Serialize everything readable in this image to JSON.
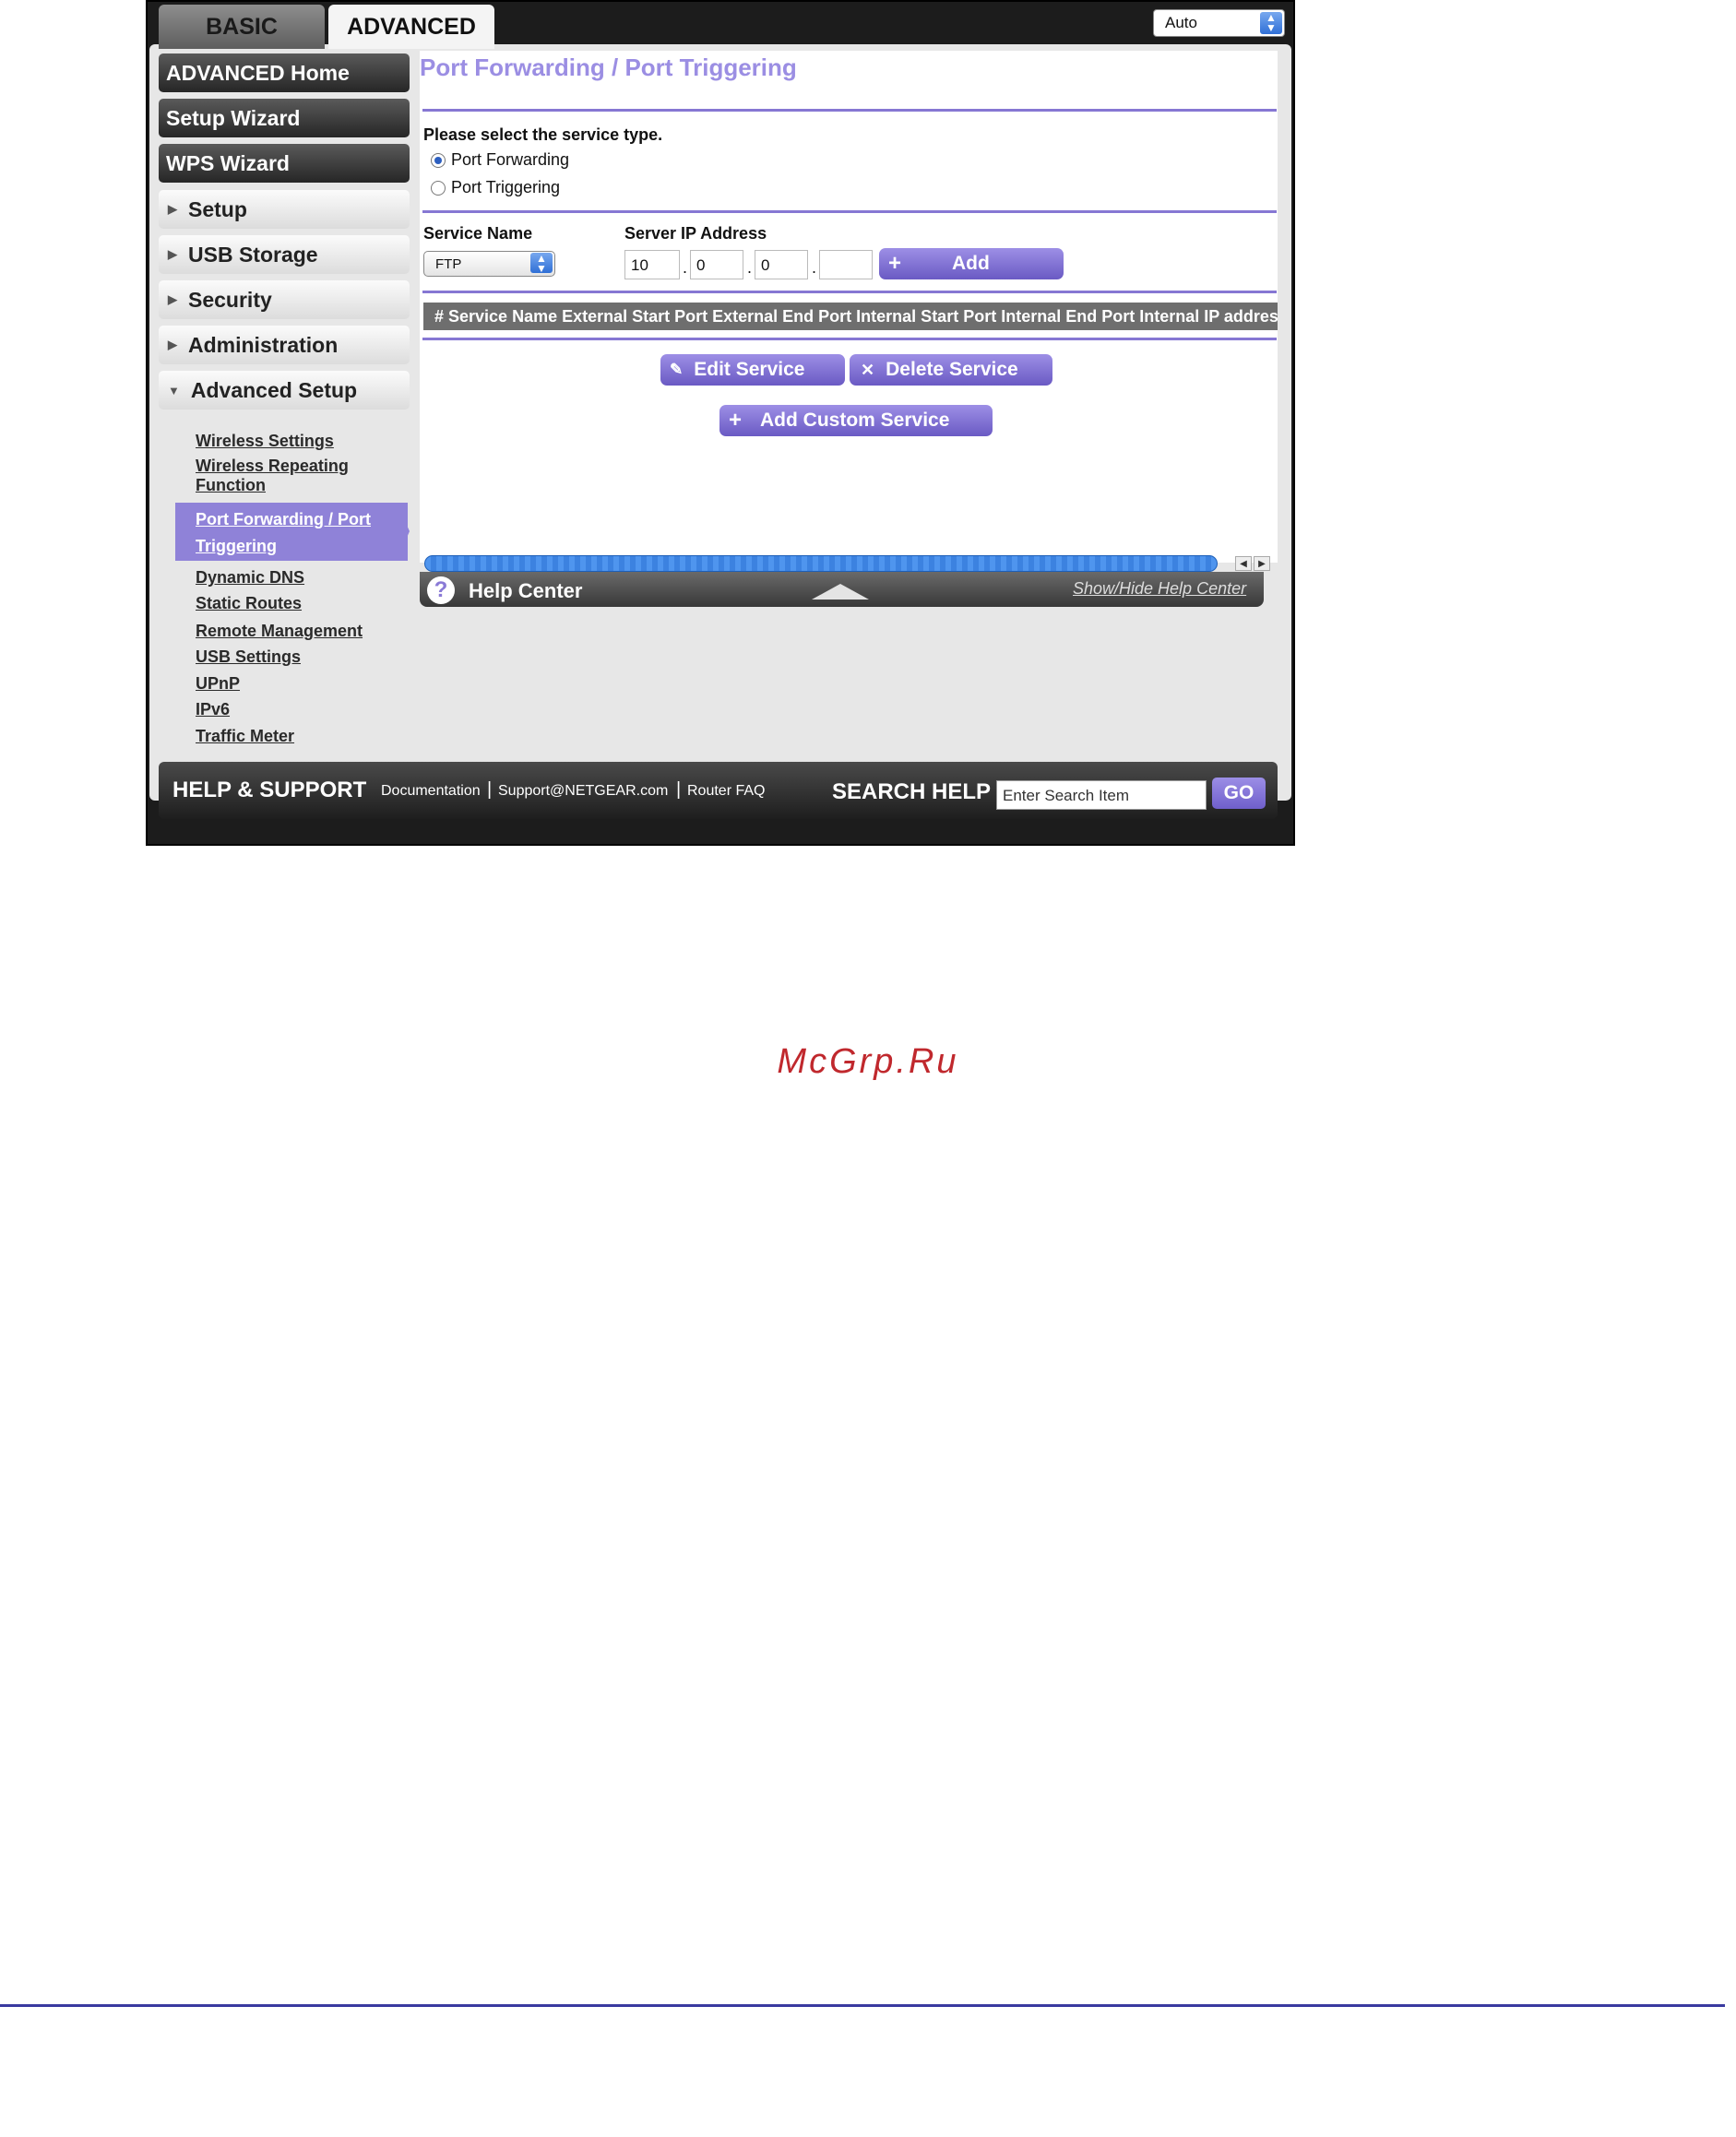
{
  "tabs": {
    "basic": "BASIC",
    "advanced": "ADVANCED"
  },
  "language_select": {
    "value": "Auto"
  },
  "sidebar": {
    "main_buttons": [
      "ADVANCED Home",
      "Setup Wizard",
      "WPS Wizard"
    ],
    "sections": [
      "Setup",
      "USB Storage",
      "Security",
      "Administration",
      "Advanced Setup"
    ],
    "sub_links": {
      "wireless_settings": "Wireless Settings",
      "wireless_repeating_1": "Wireless Repeating",
      "wireless_repeating_2": "Function",
      "port_forwarding_1": "Port Forwarding / Port",
      "port_forwarding_2": "Triggering",
      "dynamic_dns": "Dynamic DNS",
      "static_routes": "Static Routes",
      "remote_management": "Remote Management",
      "usb_settings": "USB Settings",
      "upnp": "UPnP",
      "ipv6": "IPv6",
      "traffic_meter": "Traffic Meter"
    }
  },
  "main": {
    "title": "Port Forwarding / Port Triggering",
    "service_type_prompt": "Please select the service type.",
    "radio_port_forwarding": "Port Forwarding",
    "radio_port_triggering": "Port Triggering",
    "service_name_label": "Service Name",
    "service_name_value": "FTP",
    "server_ip_label": "Server IP Address",
    "ip_octets": [
      "10",
      "0",
      "0",
      ""
    ],
    "add_label": "Add",
    "table_header": "# Service Name External Start Port External End Port Internal Start Port Internal End Port Internal IP address",
    "edit_service": "Edit Service",
    "delete_service": "Delete Service",
    "add_custom_service": "Add Custom Service"
  },
  "help_center": {
    "title": "Help Center",
    "toggle": "Show/Hide Help Center",
    "icon": "question-icon"
  },
  "footer": {
    "help_support": "HELP & SUPPORT",
    "links": [
      "Documentation",
      "Support@NETGEAR.com",
      "Router FAQ"
    ],
    "separator": "|",
    "search_help": "SEARCH HELP",
    "search_placeholder": "Enter Search Item",
    "go": "GO"
  },
  "watermark": "McGrp.Ru",
  "colors": {
    "accent": "#8677d3",
    "button": "#7b6bd0",
    "title": "#9b8ee3"
  }
}
